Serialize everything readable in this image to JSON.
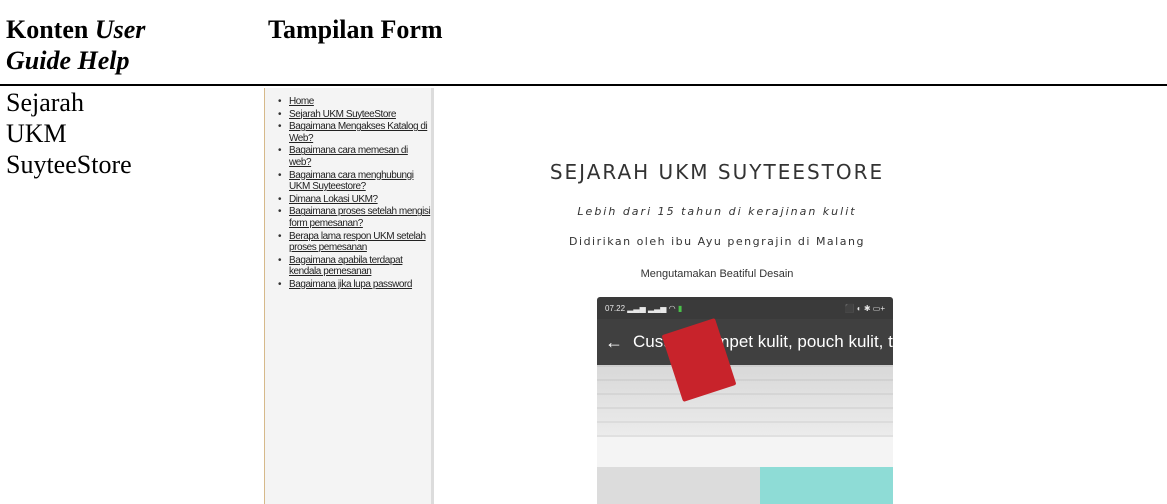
{
  "table": {
    "header_left_1": "Konten",
    "header_left_2": "User",
    "header_left_3": "Guide Help",
    "header_right": "Tampilan Form",
    "row_label_1": "Sejarah",
    "row_label_2": "UKM",
    "row_label_3": "SuyteeStore"
  },
  "sidebar": {
    "items": [
      "Home",
      "Sejarah UKM SuyteeStore",
      "Bagaimana Mengakses Katalog di Web?",
      "Bagaimana cara memesan di web?",
      "Bagaimana cara menghubungi UKM Suyteestore?",
      "Dimana Lokasi UKM?",
      "Bagaimana proses setelah mengisi form pemesanan?",
      "Berapa lama respon UKM setelah proses pemesanan",
      "Bagaimana apabila terdapat kendala pemesanan",
      "Bagaimana jika lupa password"
    ]
  },
  "page": {
    "title": "SEJARAH UKM SUYTEESTORE",
    "subtitle": "Lebih dari 15 tahun di kerajinan kulit",
    "line2": "Didirikan oleh ibu Ayu pengrajin di Malang",
    "line3": "Mengutamakan Beatiful Desain"
  },
  "phone": {
    "status_left": "07.22",
    "status_right": "⬛ ◐ ✱ ▭+",
    "back_icon": "←",
    "bar_title": "Custom dompet kulit, pouch kulit, te..."
  }
}
